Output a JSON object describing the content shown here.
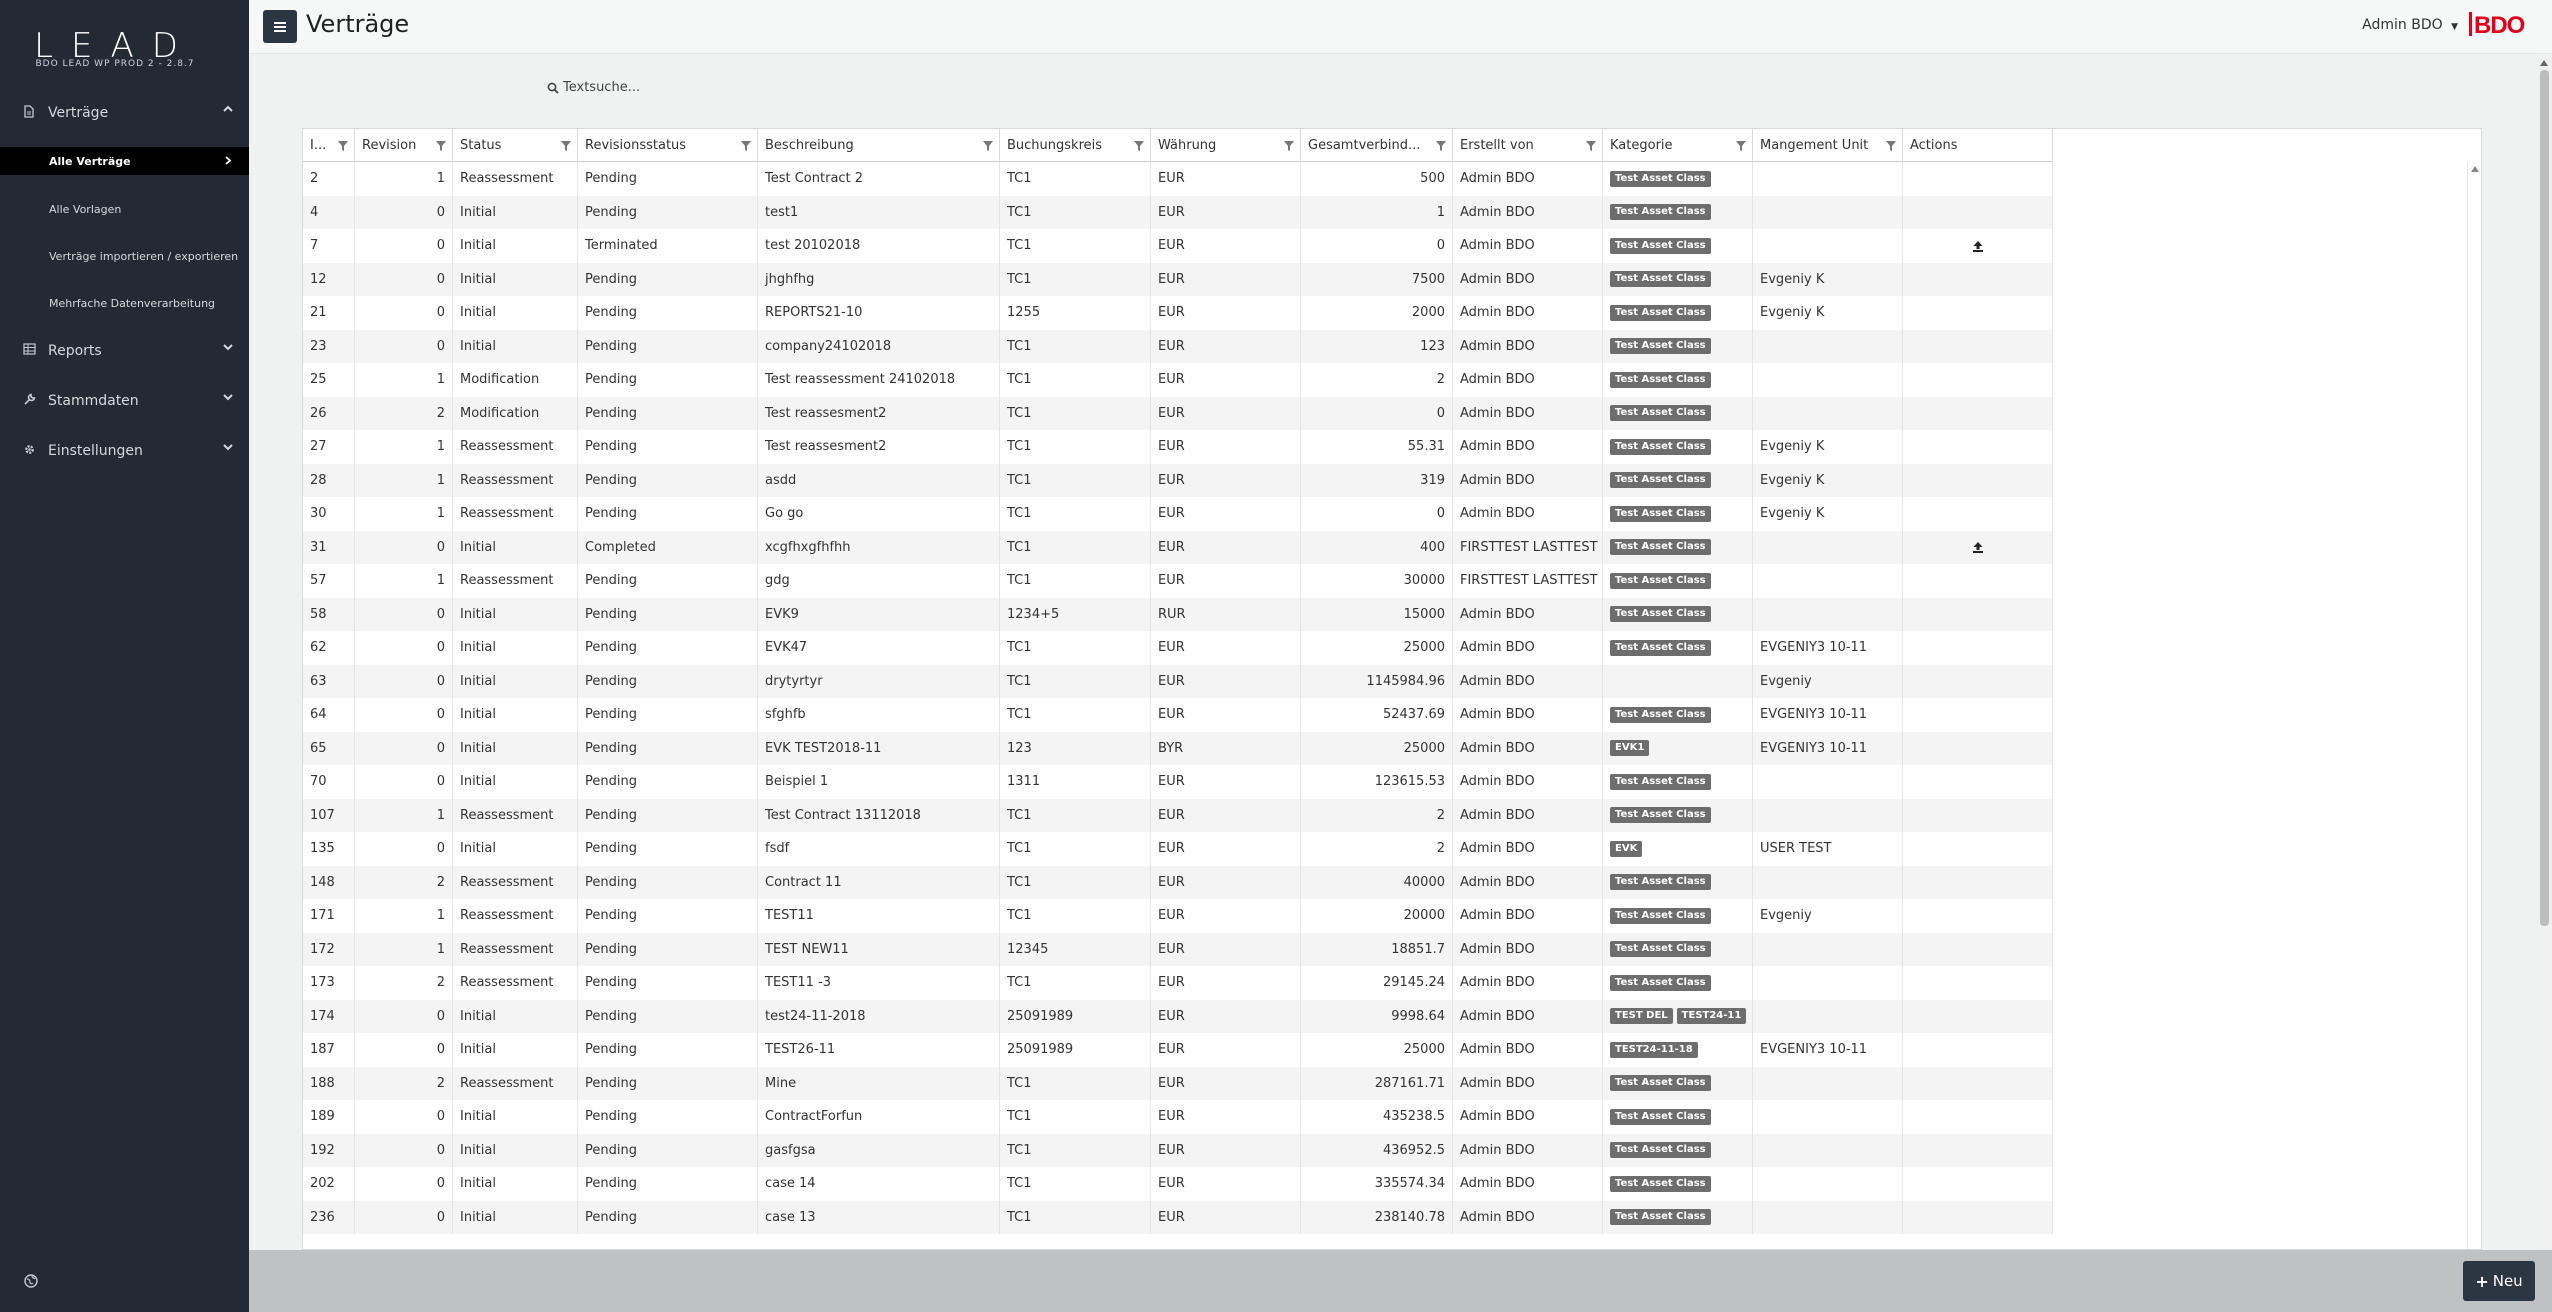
{
  "app": {
    "logo": "LEAD",
    "version": "BDO LEAD WP PROD 2 - 2.8.7",
    "title": "Verträge",
    "user": "Admin BDO",
    "brand": "BDO",
    "brand_color": "#e2001a"
  },
  "sidebar": {
    "sections": [
      {
        "label": "Verträge",
        "icon": "document-icon",
        "expanded": true
      },
      {
        "label": "Reports",
        "icon": "table-icon",
        "expanded": false
      },
      {
        "label": "Stammdaten",
        "icon": "wrench-icon",
        "expanded": false
      },
      {
        "label": "Einstellungen",
        "icon": "gear-icon",
        "expanded": false
      }
    ],
    "sub_items": [
      {
        "label": "Alle Verträge",
        "active": true
      },
      {
        "label": "Alle Vorlagen",
        "active": false
      },
      {
        "label": "Verträge importieren / exportieren",
        "active": false
      },
      {
        "label": "Mehrfache Datenverarbeitung",
        "active": false
      }
    ]
  },
  "search": {
    "label": "Textsuche..."
  },
  "grid": {
    "columns": [
      "I...",
      "Revision",
      "Status",
      "Revisionsstatus",
      "Beschreibung",
      "Buchungskreis",
      "Währung",
      "Gesamtverbind...",
      "Erstellt von",
      "Kategorie",
      "Mangement Unit",
      "Actions"
    ],
    "rows": [
      {
        "id": "2",
        "rev": "1",
        "status": "Reassessment",
        "revstatus": "Pending",
        "desc": "Test Contract 2",
        "bk": "TC1",
        "cur": "EUR",
        "total": "500",
        "by": "Admin BDO",
        "cats": [
          "Test Asset Class"
        ],
        "mu": "",
        "action": ""
      },
      {
        "id": "4",
        "rev": "0",
        "status": "Initial",
        "revstatus": "Pending",
        "desc": "test1",
        "bk": "TC1",
        "cur": "EUR",
        "total": "1",
        "by": "Admin BDO",
        "cats": [
          "Test Asset Class"
        ],
        "mu": "",
        "action": ""
      },
      {
        "id": "7",
        "rev": "0",
        "status": "Initial",
        "revstatus": "Terminated",
        "desc": "test 20102018",
        "bk": "TC1",
        "cur": "EUR",
        "total": "0",
        "by": "Admin BDO",
        "cats": [
          "Test Asset Class"
        ],
        "mu": "",
        "action": "upload-icon"
      },
      {
        "id": "12",
        "rev": "0",
        "status": "Initial",
        "revstatus": "Pending",
        "desc": "jhghfhg",
        "bk": "TC1",
        "cur": "EUR",
        "total": "7500",
        "by": "Admin BDO",
        "cats": [
          "Test Asset Class"
        ],
        "mu": "Evgeniy K",
        "action": ""
      },
      {
        "id": "21",
        "rev": "0",
        "status": "Initial",
        "revstatus": "Pending",
        "desc": "REPORTS21-10",
        "bk": "1255",
        "cur": "EUR",
        "total": "2000",
        "by": "Admin BDO",
        "cats": [
          "Test Asset Class"
        ],
        "mu": "Evgeniy K",
        "action": ""
      },
      {
        "id": "23",
        "rev": "0",
        "status": "Initial",
        "revstatus": "Pending",
        "desc": "company24102018",
        "bk": "TC1",
        "cur": "EUR",
        "total": "123",
        "by": "Admin BDO",
        "cats": [
          "Test Asset Class"
        ],
        "mu": "",
        "action": ""
      },
      {
        "id": "25",
        "rev": "1",
        "status": "Modification",
        "revstatus": "Pending",
        "desc": "Test reassessment 24102018",
        "bk": "TC1",
        "cur": "EUR",
        "total": "2",
        "by": "Admin BDO",
        "cats": [
          "Test Asset Class"
        ],
        "mu": "",
        "action": ""
      },
      {
        "id": "26",
        "rev": "2",
        "status": "Modification",
        "revstatus": "Pending",
        "desc": "Test reassesment2",
        "bk": "TC1",
        "cur": "EUR",
        "total": "0",
        "by": "Admin BDO",
        "cats": [
          "Test Asset Class"
        ],
        "mu": "",
        "action": ""
      },
      {
        "id": "27",
        "rev": "1",
        "status": "Reassessment",
        "revstatus": "Pending",
        "desc": "Test reassesment2",
        "bk": "TC1",
        "cur": "EUR",
        "total": "55.31",
        "by": "Admin BDO",
        "cats": [
          "Test Asset Class"
        ],
        "mu": "Evgeniy K",
        "action": ""
      },
      {
        "id": "28",
        "rev": "1",
        "status": "Reassessment",
        "revstatus": "Pending",
        "desc": "asdd",
        "bk": "TC1",
        "cur": "EUR",
        "total": "319",
        "by": "Admin BDO",
        "cats": [
          "Test Asset Class"
        ],
        "mu": "Evgeniy K",
        "action": ""
      },
      {
        "id": "30",
        "rev": "1",
        "status": "Reassessment",
        "revstatus": "Pending",
        "desc": "Go go",
        "bk": "TC1",
        "cur": "EUR",
        "total": "0",
        "by": "Admin BDO",
        "cats": [
          "Test Asset Class"
        ],
        "mu": "Evgeniy K",
        "action": ""
      },
      {
        "id": "31",
        "rev": "0",
        "status": "Initial",
        "revstatus": "Completed",
        "desc": "xcgfhxgfhfhh",
        "bk": "TC1",
        "cur": "EUR",
        "total": "400",
        "by": "FIRSTTEST LASTTEST",
        "cats": [
          "Test Asset Class"
        ],
        "mu": "",
        "action": "upload-icon"
      },
      {
        "id": "57",
        "rev": "1",
        "status": "Reassessment",
        "revstatus": "Pending",
        "desc": "gdg",
        "bk": "TC1",
        "cur": "EUR",
        "total": "30000",
        "by": "FIRSTTEST LASTTEST",
        "cats": [
          "Test Asset Class"
        ],
        "mu": "",
        "action": ""
      },
      {
        "id": "58",
        "rev": "0",
        "status": "Initial",
        "revstatus": "Pending",
        "desc": "EVK9",
        "bk": "1234+5",
        "cur": "RUR",
        "total": "15000",
        "by": "Admin BDO",
        "cats": [
          "Test Asset Class"
        ],
        "mu": "",
        "action": ""
      },
      {
        "id": "62",
        "rev": "0",
        "status": "Initial",
        "revstatus": "Pending",
        "desc": "EVK47",
        "bk": "TC1",
        "cur": "EUR",
        "total": "25000",
        "by": "Admin BDO",
        "cats": [
          "Test Asset Class"
        ],
        "mu": "EVGENIY3 10-11",
        "action": ""
      },
      {
        "id": "63",
        "rev": "0",
        "status": "Initial",
        "revstatus": "Pending",
        "desc": "drytyrtyr",
        "bk": "TC1",
        "cur": "EUR",
        "total": "1145984.96",
        "by": "Admin BDO",
        "cats": [],
        "mu": "Evgeniy",
        "action": ""
      },
      {
        "id": "64",
        "rev": "0",
        "status": "Initial",
        "revstatus": "Pending",
        "desc": "sfghfb",
        "bk": "TC1",
        "cur": "EUR",
        "total": "52437.69",
        "by": "Admin BDO",
        "cats": [
          "Test Asset Class"
        ],
        "mu": "EVGENIY3 10-11",
        "action": ""
      },
      {
        "id": "65",
        "rev": "0",
        "status": "Initial",
        "revstatus": "Pending",
        "desc": "EVK TEST2018-11",
        "bk": "123",
        "cur": "BYR",
        "total": "25000",
        "by": "Admin BDO",
        "cats": [
          "EVK1"
        ],
        "mu": "EVGENIY3 10-11",
        "action": ""
      },
      {
        "id": "70",
        "rev": "0",
        "status": "Initial",
        "revstatus": "Pending",
        "desc": "Beispiel 1",
        "bk": "1311",
        "cur": "EUR",
        "total": "123615.53",
        "by": "Admin BDO",
        "cats": [
          "Test Asset Class"
        ],
        "mu": "",
        "action": ""
      },
      {
        "id": "107",
        "rev": "1",
        "status": "Reassessment",
        "revstatus": "Pending",
        "desc": "Test Contract 13112018",
        "bk": "TC1",
        "cur": "EUR",
        "total": "2",
        "by": "Admin BDO",
        "cats": [
          "Test Asset Class"
        ],
        "mu": "",
        "action": ""
      },
      {
        "id": "135",
        "rev": "0",
        "status": "Initial",
        "revstatus": "Pending",
        "desc": "fsdf",
        "bk": "TC1",
        "cur": "EUR",
        "total": "2",
        "by": "Admin BDO",
        "cats": [
          "EVK"
        ],
        "mu": "USER TEST",
        "action": ""
      },
      {
        "id": "148",
        "rev": "2",
        "status": "Reassessment",
        "revstatus": "Pending",
        "desc": "Contract 11",
        "bk": "TC1",
        "cur": "EUR",
        "total": "40000",
        "by": "Admin BDO",
        "cats": [
          "Test Asset Class"
        ],
        "mu": "",
        "action": ""
      },
      {
        "id": "171",
        "rev": "1",
        "status": "Reassessment",
        "revstatus": "Pending",
        "desc": "TEST11",
        "bk": "TC1",
        "cur": "EUR",
        "total": "20000",
        "by": "Admin BDO",
        "cats": [
          "Test Asset Class"
        ],
        "mu": "Evgeniy",
        "action": ""
      },
      {
        "id": "172",
        "rev": "1",
        "status": "Reassessment",
        "revstatus": "Pending",
        "desc": "TEST NEW11",
        "bk": "12345",
        "cur": "EUR",
        "total": "18851.7",
        "by": "Admin BDO",
        "cats": [
          "Test Asset Class"
        ],
        "mu": "",
        "action": ""
      },
      {
        "id": "173",
        "rev": "2",
        "status": "Reassessment",
        "revstatus": "Pending",
        "desc": "TEST11 -3",
        "bk": "TC1",
        "cur": "EUR",
        "total": "29145.24",
        "by": "Admin BDO",
        "cats": [
          "Test Asset Class"
        ],
        "mu": "",
        "action": ""
      },
      {
        "id": "174",
        "rev": "0",
        "status": "Initial",
        "revstatus": "Pending",
        "desc": "test24-11-2018",
        "bk": "25091989",
        "cur": "EUR",
        "total": "9998.64",
        "by": "Admin BDO",
        "cats": [
          "TEST DEL",
          "TEST24-11"
        ],
        "mu": "",
        "action": ""
      },
      {
        "id": "187",
        "rev": "0",
        "status": "Initial",
        "revstatus": "Pending",
        "desc": "TEST26-11",
        "bk": "25091989",
        "cur": "EUR",
        "total": "25000",
        "by": "Admin BDO",
        "cats": [
          "TEST24-11-18"
        ],
        "mu": "EVGENIY3 10-11",
        "action": ""
      },
      {
        "id": "188",
        "rev": "2",
        "status": "Reassessment",
        "revstatus": "Pending",
        "desc": "Mine",
        "bk": "TC1",
        "cur": "EUR",
        "total": "287161.71",
        "by": "Admin BDO",
        "cats": [
          "Test Asset Class"
        ],
        "mu": "",
        "action": ""
      },
      {
        "id": "189",
        "rev": "0",
        "status": "Initial",
        "revstatus": "Pending",
        "desc": "ContractForfun",
        "bk": "TC1",
        "cur": "EUR",
        "total": "435238.5",
        "by": "Admin BDO",
        "cats": [
          "Test Asset Class"
        ],
        "mu": "",
        "action": ""
      },
      {
        "id": "192",
        "rev": "0",
        "status": "Initial",
        "revstatus": "Pending",
        "desc": "gasfgsa",
        "bk": "TC1",
        "cur": "EUR",
        "total": "436952.5",
        "by": "Admin BDO",
        "cats": [
          "Test Asset Class"
        ],
        "mu": "",
        "action": ""
      },
      {
        "id": "202",
        "rev": "0",
        "status": "Initial",
        "revstatus": "Pending",
        "desc": "case 14",
        "bk": "TC1",
        "cur": "EUR",
        "total": "335574.34",
        "by": "Admin BDO",
        "cats": [
          "Test Asset Class"
        ],
        "mu": "",
        "action": ""
      },
      {
        "id": "236",
        "rev": "0",
        "status": "Initial",
        "revstatus": "Pending",
        "desc": "case 13",
        "bk": "TC1",
        "cur": "EUR",
        "total": "238140.78",
        "by": "Admin BDO",
        "cats": [
          "Test Asset Class"
        ],
        "mu": "",
        "action": ""
      }
    ]
  },
  "footer": {
    "new_label": "Neu"
  }
}
